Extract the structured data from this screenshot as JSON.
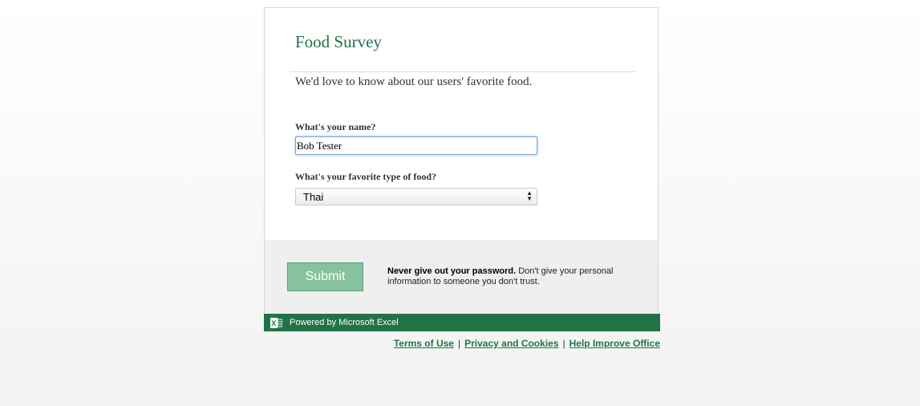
{
  "form": {
    "title": "Food Survey",
    "description": "We'd love to know about our users' favorite food.",
    "questions": [
      {
        "label": "What's your name?",
        "value": "Bob Tester"
      },
      {
        "label": "What's your favorite type of food?",
        "value": "Thai"
      }
    ]
  },
  "footer": {
    "submit_label": "Submit",
    "notice_bold": "Never give out your password.",
    "notice_text": " Don't give your personal information to someone you don't trust."
  },
  "branding": {
    "powered_by": "Powered by Microsoft Excel",
    "accent_color": "#217346",
    "icon": "excel-icon"
  },
  "links": [
    "Terms of Use",
    "Privacy and Cookies",
    "Help Improve Office"
  ]
}
